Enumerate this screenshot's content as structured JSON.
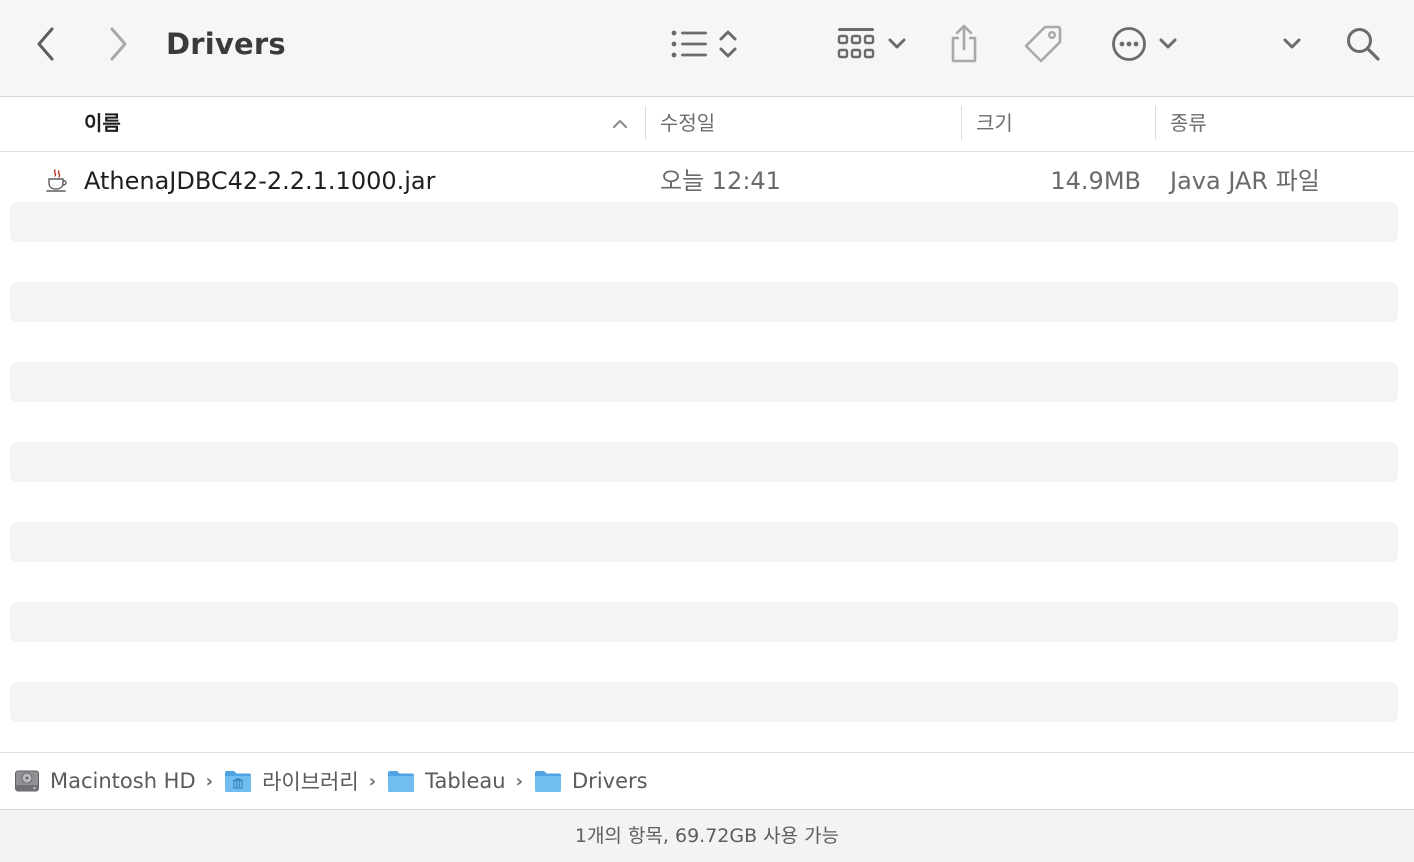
{
  "toolbar": {
    "title": "Drivers",
    "icons": [
      "back-icon",
      "forward-icon",
      "list-view-icon",
      "sort-updown-icon",
      "group-grid-icon",
      "chevron-down-icon",
      "share-icon",
      "tag-icon",
      "more-ellipsis-icon",
      "search-icon"
    ]
  },
  "columns": {
    "name": "이름",
    "modified": "수정일",
    "size": "크기",
    "kind": "종류"
  },
  "files": [
    {
      "name": "AthenaJDBC42-2.2.1.1000.jar",
      "modified": "오늘 12:41",
      "size": "14.9MB",
      "kind": "Java JAR 파일",
      "icon": "java-cup-icon"
    }
  ],
  "path": [
    {
      "label": "Macintosh HD",
      "icon": "hard-drive-icon"
    },
    {
      "label": "라이브러리",
      "icon": "library-folder-icon"
    },
    {
      "label": "Tableau",
      "icon": "folder-icon"
    },
    {
      "label": "Drivers",
      "icon": "folder-icon"
    }
  ],
  "path_separator": "›",
  "status": "1개의 항목, 69.72GB 사용 가능",
  "colors": {
    "toolbar_bg": "#f6f6f6",
    "stripe": "#f4f4f5",
    "folder_blue": "#5aaee8",
    "icon_gray": "#6b6b6b"
  }
}
